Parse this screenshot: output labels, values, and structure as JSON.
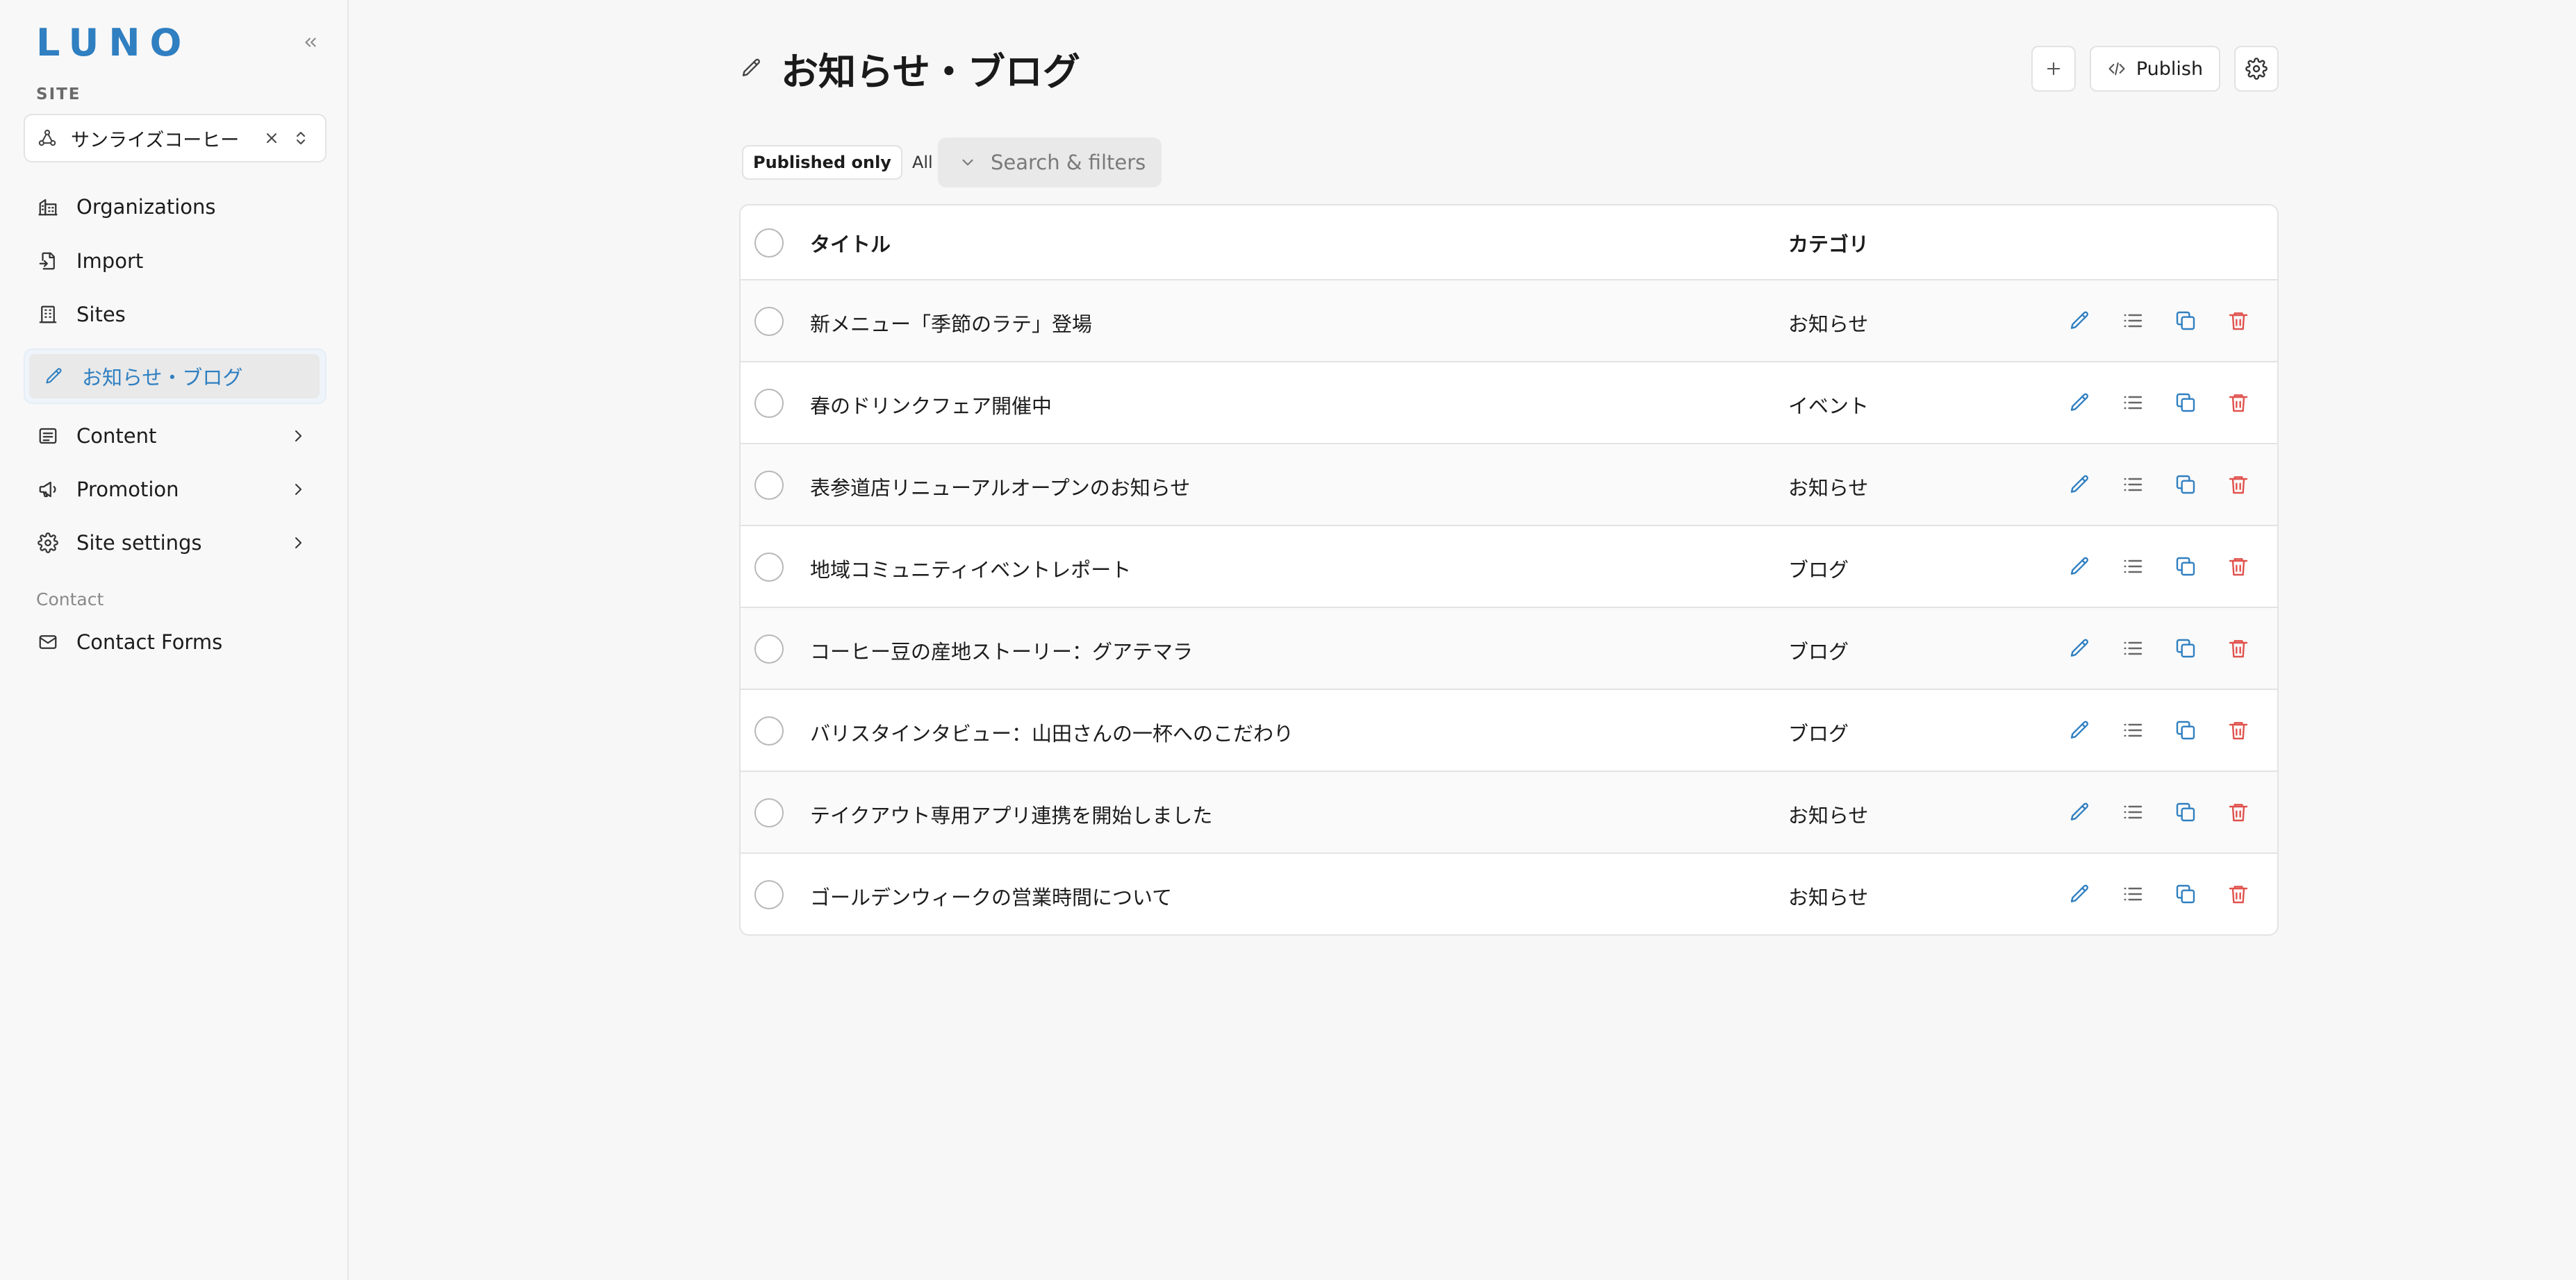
{
  "brand": {
    "logo": "LUNO"
  },
  "sidebar": {
    "site_label": "SITE",
    "site_select": {
      "value": "サンライズコーヒー"
    },
    "items": [
      {
        "label": "Organizations",
        "icon": "building-icon"
      },
      {
        "label": "Import",
        "icon": "file-import-icon"
      },
      {
        "label": "Sites",
        "icon": "office-building-icon"
      },
      {
        "label": "お知らせ・ブログ",
        "icon": "pencil-icon",
        "active": true
      },
      {
        "label": "Content",
        "icon": "list-box-icon",
        "expandable": true
      },
      {
        "label": "Promotion",
        "icon": "megaphone-icon",
        "expandable": true
      },
      {
        "label": "Site settings",
        "icon": "gear-icon",
        "expandable": true
      }
    ],
    "contact_section_label": "Contact",
    "contact_items": [
      {
        "label": "Contact Forms",
        "icon": "mail-icon"
      }
    ]
  },
  "header": {
    "title": "お知らせ・ブログ",
    "publish_label": "Publish"
  },
  "filters": {
    "published_only": "Published only",
    "all": "All",
    "search_label": "Search & filters"
  },
  "table": {
    "columns": [
      "タイトル",
      "カテゴリ"
    ],
    "rows": [
      {
        "title": "新メニュー「季節のラテ」登場",
        "category": "お知らせ"
      },
      {
        "title": "春のドリンクフェア開催中",
        "category": "イベント"
      },
      {
        "title": "表参道店リニューアルオープンのお知らせ",
        "category": "お知らせ"
      },
      {
        "title": "地域コミュニティイベントレポート",
        "category": "ブログ"
      },
      {
        "title": "コーヒー豆の産地ストーリー：グアテマラ",
        "category": "ブログ"
      },
      {
        "title": "バリスタインタビュー：山田さんの一杯へのこだわり",
        "category": "ブログ"
      },
      {
        "title": "テイクアウト専用アプリ連携を開始しました",
        "category": "お知らせ"
      },
      {
        "title": "ゴールデンウィークの営業時間について",
        "category": "お知らせ"
      }
    ]
  },
  "colors": {
    "accent": "#2f7fc1",
    "danger": "#e0524d",
    "text": "#1c1c1c",
    "muted": "#7a7a7a"
  }
}
